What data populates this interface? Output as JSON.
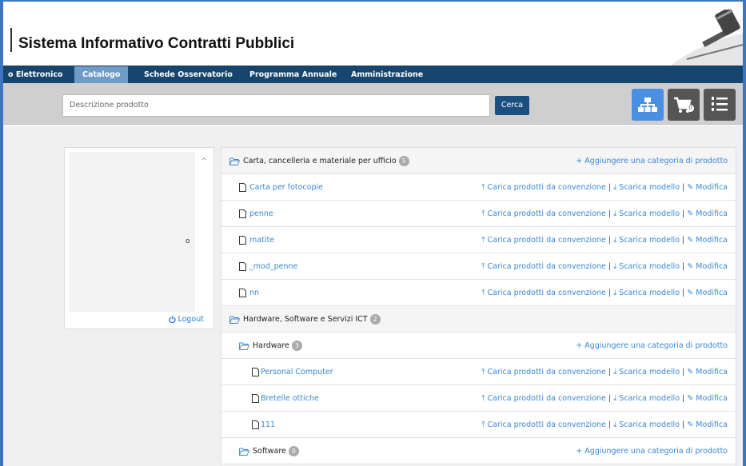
{
  "header": {
    "title": "Sistema Informativo Contratti Pubblici"
  },
  "nav": {
    "items": [
      {
        "label": "o Elettronico",
        "active": false
      },
      {
        "label": "Catalogo",
        "active": true
      },
      {
        "label": "Schede Osservatorio",
        "active": false
      },
      {
        "label": "Programma Annuale",
        "active": false
      },
      {
        "label": "Amministrazione",
        "active": false
      }
    ]
  },
  "search": {
    "placeholder": "Descrizione prodotto",
    "button": "Cerca"
  },
  "toolbar": {
    "cart_count": "0"
  },
  "sidebar": {
    "fragment": "o",
    "logout": "Logout"
  },
  "actions": {
    "add_category": "Aggiungere una categoria di prodotto",
    "upload": "Carica prodotti da convenzione",
    "download": "Scarica modello",
    "edit": "Modifica",
    "sep": "|"
  },
  "tree": {
    "cat1": {
      "label": "Carta, cancelleria e materiale per ufficio",
      "count": "5"
    },
    "cat1_items": [
      "Carta per fotocopie",
      "penne",
      "matite",
      "_mod_penne",
      "nn"
    ],
    "cat2": {
      "label": "Hardware, Software e Servizi ICT",
      "count": "2"
    },
    "hw": {
      "label": "Hardware",
      "count": "3"
    },
    "hw_items": [
      "Personal Computer",
      "Bretelle ottiche",
      "111"
    ],
    "sw": {
      "label": "Software",
      "count": "0"
    }
  },
  "colors": {
    "nav": "#16466e",
    "nav_active": "#6f9bc7",
    "link": "#3a87d6",
    "accent": "#4a90e2"
  }
}
